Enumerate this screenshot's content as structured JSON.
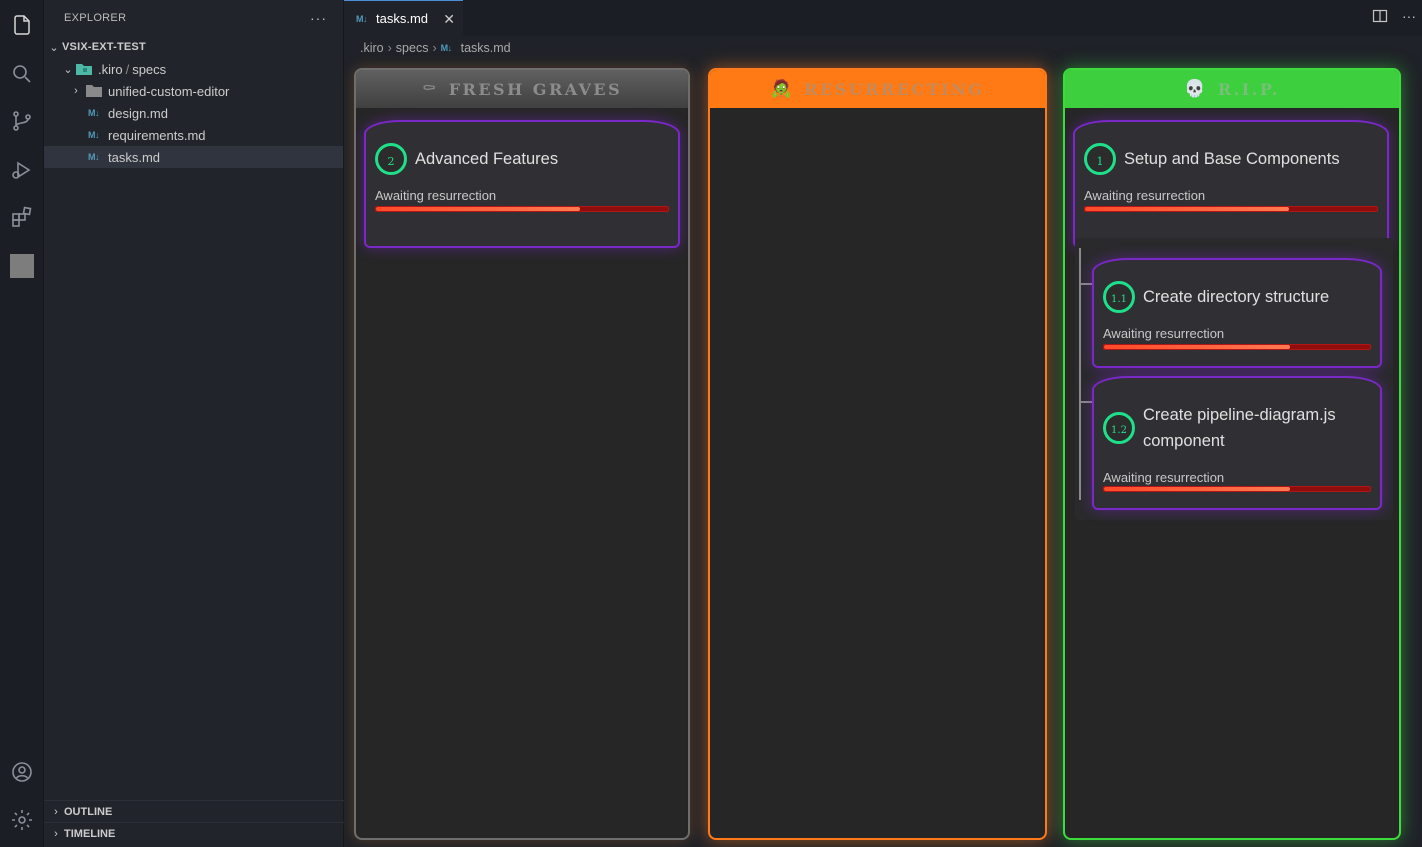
{
  "sidebar": {
    "title": "EXPLORER",
    "more": "···",
    "project": "VSIX-EXT-TEST",
    "folder_kiro": ".kiro",
    "folder_slash": "/",
    "folder_specs": "specs",
    "items": [
      {
        "label": "unified-custom-editor",
        "type": "folder"
      },
      {
        "label": "design.md",
        "type": "md"
      },
      {
        "label": "requirements.md",
        "type": "md"
      },
      {
        "label": "tasks.md",
        "type": "md",
        "selected": true
      }
    ],
    "outline": "OUTLINE",
    "timeline": "TIMELINE",
    "md_glyph": "M↓"
  },
  "tab": {
    "label": "tasks.md",
    "close": "✕"
  },
  "breadcrumb": [
    ".kiro",
    "specs",
    "tasks.md"
  ],
  "columns": [
    {
      "title": "FRESH GRAVES",
      "emoji": "⚰"
    },
    {
      "title": "RESURRECTING",
      "emoji": "🧟"
    },
    {
      "title": "R.I.P.",
      "emoji": "💀"
    }
  ],
  "cards": [
    {
      "id": "2",
      "title": "Advanced Features",
      "status": "Awaiting resurrection",
      "progress": 0.7
    },
    {
      "id": "1",
      "title": "Setup and Base Components",
      "status": "Awaiting resurrection",
      "progress": 0.7
    },
    {
      "id": "1.1",
      "title": "Create directory structure",
      "status": "Awaiting resurrection",
      "progress": 0.7
    },
    {
      "id": "1.2",
      "title_line1": "Create pipeline-diagram.js",
      "title_line2": "component",
      "status": "Awaiting resurrection",
      "progress": 0.7
    }
  ],
  "colors": {
    "accent": "#4d8fd6",
    "fresh": "#6e6e6e",
    "resurrecting": "#ff7a1a",
    "rip": "#3ddc3d",
    "card_border": "#7a28c8",
    "badge": "#1ee08a"
  }
}
